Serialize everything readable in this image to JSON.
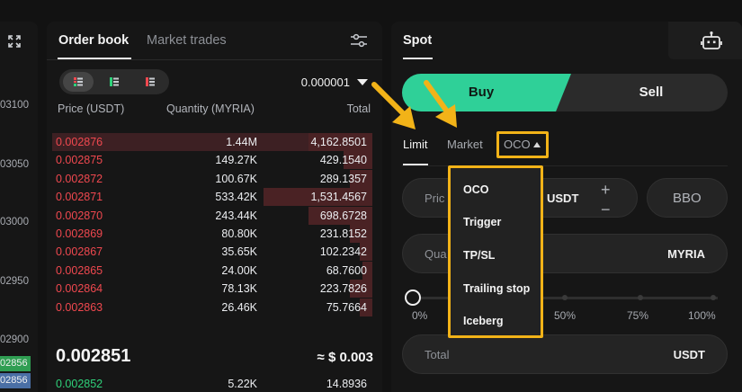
{
  "chart_strip": {
    "expand_icon": "expand-icon",
    "ticks": [
      "03100",
      "03050",
      "03000",
      "02950",
      "02900"
    ],
    "badges": [
      {
        "label": "02856",
        "color": "#2f9e52"
      },
      {
        "label": "02856",
        "color": "#4a6fa5"
      }
    ]
  },
  "orderbook": {
    "tabs": [
      "Order book",
      "Market trades"
    ],
    "active_tab": "Order book",
    "settings_icon": "sliders-icon",
    "view_modes": [
      "both-sides-icon",
      "bids-only-icon",
      "asks-only-icon"
    ],
    "precision": "0.000001",
    "columns": [
      "Price (USDT)",
      "Quantity (MYRIA)",
      "Total"
    ],
    "asks": [
      {
        "price": "0.002876",
        "qty": "1.44M",
        "total": "4,162.8501",
        "depth": 0.2
      },
      {
        "price": "0.002875",
        "qty": "149.27K",
        "total": "429.1540",
        "depth": 0.09
      },
      {
        "price": "0.002872",
        "qty": "100.67K",
        "total": "289.1357",
        "depth": 0.07
      },
      {
        "price": "0.002871",
        "qty": "533.42K",
        "total": "1,531.4567",
        "depth": 0.34
      },
      {
        "price": "0.002870",
        "qty": "243.44K",
        "total": "698.6728",
        "depth": 0.2
      },
      {
        "price": "0.002869",
        "qty": "80.80K",
        "total": "231.8152",
        "depth": 0.07
      },
      {
        "price": "0.002867",
        "qty": "35.65K",
        "total": "102.2342",
        "depth": 0.04
      },
      {
        "price": "0.002865",
        "qty": "24.00K",
        "total": "68.7600",
        "depth": 0.03
      },
      {
        "price": "0.002864",
        "qty": "78.13K",
        "total": "223.7826",
        "depth": 0.07
      },
      {
        "price": "0.002863",
        "qty": "26.46K",
        "total": "75.7664",
        "depth": 0.04
      }
    ],
    "last_price": "0.002851",
    "last_price_usd": "≈ $ 0.003",
    "bids": [
      {
        "price": "0.002852",
        "qty": "5.22K",
        "total": "14.8936"
      }
    ]
  },
  "spot": {
    "tab": "Spot",
    "robot_icon": "trading-bot-icon",
    "buy_label": "Buy",
    "sell_label": "Sell",
    "order_types": {
      "limit": "Limit",
      "market": "Market",
      "oco": "OCO"
    },
    "price_field": {
      "label": "Pric",
      "unit": "USDT"
    },
    "bbo_label": "BBO",
    "quantity_field": {
      "label": "Qua",
      "unit": "MYRIA"
    },
    "slider": {
      "value_percent": 0,
      "labels": [
        "0%",
        "25%",
        "50%",
        "75%",
        "100%"
      ]
    },
    "total_field": {
      "label": "Total",
      "unit": "USDT"
    },
    "highlight_color": "#f2b318",
    "buy_color": "#2fd098"
  },
  "oco_dropdown": {
    "items": [
      "OCO",
      "Trigger",
      "TP/SL",
      "Trailing stop",
      "Iceberg"
    ]
  }
}
